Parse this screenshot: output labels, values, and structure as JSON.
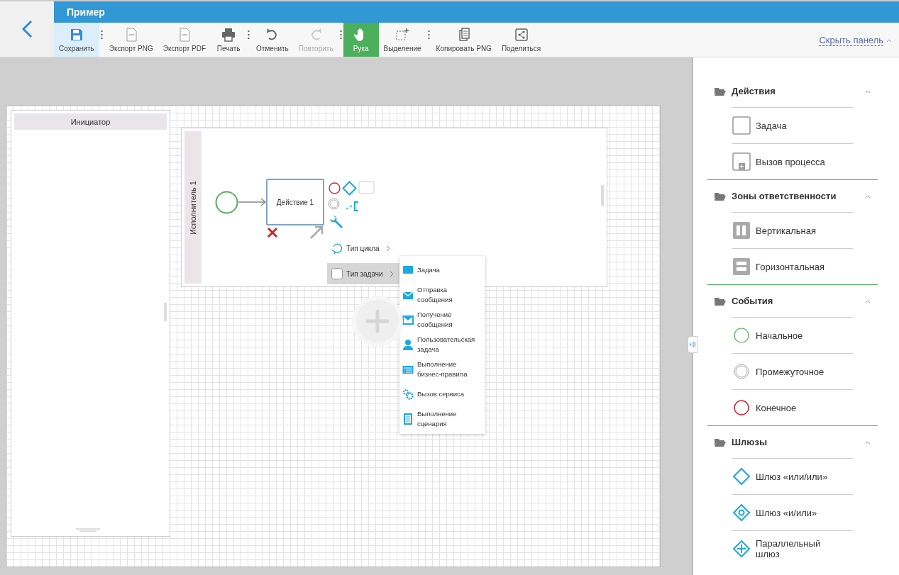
{
  "window": {
    "title": "Пример"
  },
  "toolbar": [
    {
      "label": "Сохранить",
      "kind": "save",
      "highlighted": true,
      "selected": false,
      "disabled": false,
      "separator_after": true
    },
    {
      "label": "Экспорт PNG",
      "kind": "png",
      "highlighted": false,
      "selected": false,
      "disabled": false,
      "separator_after": false
    },
    {
      "label": "Экспорт PDF",
      "kind": "pdf",
      "highlighted": false,
      "selected": false,
      "disabled": false,
      "separator_after": false
    },
    {
      "label": "Печать",
      "kind": "print",
      "highlighted": false,
      "selected": false,
      "disabled": false,
      "separator_after": true
    },
    {
      "label": "Отменить",
      "kind": "undo",
      "highlighted": false,
      "selected": false,
      "disabled": false,
      "separator_after": false
    },
    {
      "label": "Повторить",
      "kind": "redo",
      "highlighted": false,
      "selected": false,
      "disabled": true,
      "separator_after": true
    },
    {
      "label": "Рука",
      "kind": "hand",
      "highlighted": false,
      "selected": true,
      "disabled": false,
      "separator_after": false
    },
    {
      "label": "Выделение",
      "kind": "selection",
      "highlighted": false,
      "selected": false,
      "disabled": false,
      "separator_after": true
    },
    {
      "label": "Копировать PNG",
      "kind": "copy",
      "highlighted": false,
      "selected": false,
      "disabled": false,
      "separator_after": false
    },
    {
      "label": "Поделиться",
      "kind": "share",
      "highlighted": false,
      "selected": false,
      "disabled": false,
      "separator_after": false
    }
  ],
  "panel_toggle": {
    "label": "Скрыть панель",
    "expanded": true
  },
  "canvas": {
    "pools": [
      {
        "label": "Инициатор"
      }
    ],
    "lane": {
      "label": "Исполнитель 1"
    },
    "task": {
      "label": "Действие 1"
    },
    "context_menu": [
      {
        "label": "Тип цикла",
        "kind": "loop",
        "selected": false
      },
      {
        "label": "Тип задачи",
        "kind": "task",
        "selected": true
      }
    ],
    "submenu": [
      {
        "label": "Задача",
        "kind": "task"
      },
      {
        "label": "Отправка сообщения",
        "kind": "send"
      },
      {
        "label": "Получение сообщения",
        "kind": "receive"
      },
      {
        "label": "Пользовательская задача",
        "kind": "user"
      },
      {
        "label": "Выполнение бизнес-правила",
        "kind": "rule"
      },
      {
        "label": "Вызов сервиса",
        "kind": "service"
      },
      {
        "label": "Выполнение сценария",
        "kind": "script"
      }
    ]
  },
  "sidebar": {
    "sections": [
      {
        "title": "Действия",
        "expanded": true,
        "items": [
          {
            "label": "Задача",
            "kind": "task"
          },
          {
            "label": "Вызов процесса",
            "kind": "subprocess"
          }
        ]
      },
      {
        "title": "Зоны ответственности",
        "expanded": true,
        "items": [
          {
            "label": "Вертикальная",
            "kind": "vertical"
          },
          {
            "label": "Горизонтальная",
            "kind": "horizontal"
          }
        ]
      },
      {
        "title": "События",
        "expanded": true,
        "items": [
          {
            "label": "Начальное",
            "kind": "start"
          },
          {
            "label": "Промежуточное",
            "kind": "intermediate"
          },
          {
            "label": "Конечное",
            "kind": "end"
          }
        ]
      },
      {
        "title": "Шлюзы",
        "expanded": true,
        "items": [
          {
            "label": "Шлюз «или/или»",
            "kind": "xor"
          },
          {
            "label": "Шлюз «и/или»",
            "kind": "or"
          },
          {
            "label": "Параллельный шлюз",
            "kind": "parallel"
          }
        ]
      }
    ]
  }
}
